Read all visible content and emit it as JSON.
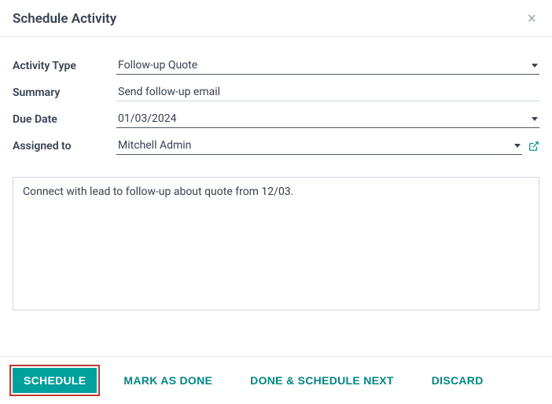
{
  "modal": {
    "title": "Schedule Activity"
  },
  "form": {
    "activity_type": {
      "label": "Activity Type",
      "value": "Follow-up Quote"
    },
    "summary": {
      "label": "Summary",
      "value": "Send follow-up email"
    },
    "due_date": {
      "label": "Due Date",
      "value": "01/03/2024"
    },
    "assigned_to": {
      "label": "Assigned to",
      "value": "Mitchell Admin"
    },
    "notes": "Connect with lead to follow-up about quote from 12/03."
  },
  "footer": {
    "schedule": "Schedule",
    "mark_done": "Mark As Done",
    "done_next": "Done & Schedule Next",
    "discard": "Discard"
  }
}
